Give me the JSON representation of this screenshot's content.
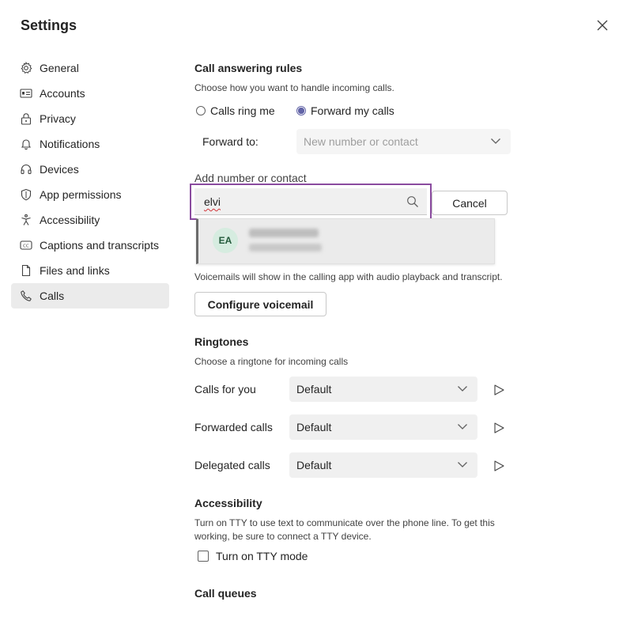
{
  "header": {
    "title": "Settings"
  },
  "sidebar": {
    "items": [
      {
        "label": "General",
        "icon": "gear-icon"
      },
      {
        "label": "Accounts",
        "icon": "id-card-icon"
      },
      {
        "label": "Privacy",
        "icon": "lock-icon"
      },
      {
        "label": "Notifications",
        "icon": "bell-icon"
      },
      {
        "label": "Devices",
        "icon": "headset-icon"
      },
      {
        "label": "App permissions",
        "icon": "shield-icon"
      },
      {
        "label": "Accessibility",
        "icon": "accessibility-icon"
      },
      {
        "label": "Captions and transcripts",
        "icon": "cc-icon"
      },
      {
        "label": "Files and links",
        "icon": "file-icon"
      },
      {
        "label": "Calls",
        "icon": "phone-icon",
        "active": true
      }
    ]
  },
  "call_answering": {
    "heading": "Call answering rules",
    "description": "Choose how you want to handle incoming calls.",
    "option_ring": "Calls ring me",
    "option_forward": "Forward my calls",
    "forward_label": "Forward to:",
    "forward_placeholder": "New number or contact",
    "add_label": "Add number or contact",
    "search_value": "elvi",
    "cancel_label": "Cancel",
    "suggestion": {
      "initials": "EA"
    }
  },
  "voicemail": {
    "description": "Voicemails will show in the calling app with audio playback and transcript.",
    "configure_label": "Configure voicemail"
  },
  "ringtones": {
    "heading": "Ringtones",
    "description": "Choose a ringtone for incoming calls",
    "rows": [
      {
        "label": "Calls for you",
        "value": "Default"
      },
      {
        "label": "Forwarded calls",
        "value": "Default"
      },
      {
        "label": "Delegated calls",
        "value": "Default"
      }
    ]
  },
  "accessibility": {
    "heading": "Accessibility",
    "description_line1": "Turn on TTY to use text to communicate over the phone line. To get this",
    "description_line2": "working, be sure to connect a TTY device.",
    "tty_label": "Turn on TTY mode"
  },
  "call_queues": {
    "heading": "Call queues"
  },
  "colors": {
    "accent": "#6264a7",
    "focus_border": "#8a4b9f",
    "avatar_bg": "#d6ece0"
  }
}
